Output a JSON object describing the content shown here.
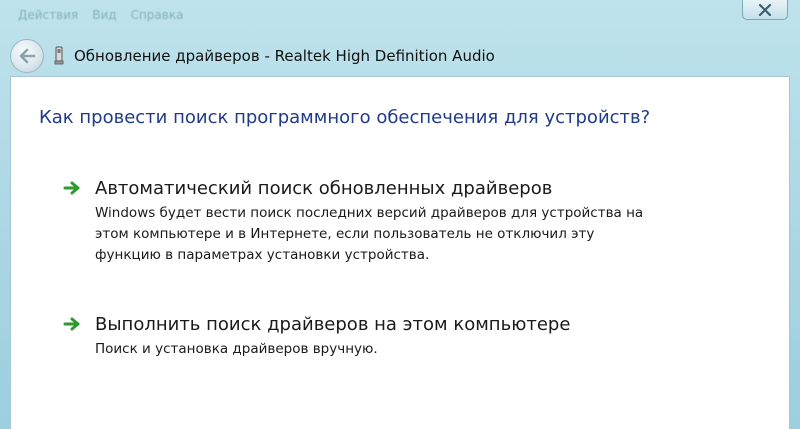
{
  "menu": {
    "items": [
      "Действия",
      "Вид",
      "Справка"
    ]
  },
  "window": {
    "title": "Обновление драйверов - Realtek High Definition Audio"
  },
  "content": {
    "heading": "Как провести поиск программного обеспечения для устройств?",
    "options": [
      {
        "title": "Автоматический поиск обновленных драйверов",
        "description": "Windows будет вести поиск последних версий драйверов для устройства на этом компьютере и в Интернете, если пользователь не отключил эту функцию в параметрах установки устройства."
      },
      {
        "title": "Выполнить поиск драйверов на этом компьютере",
        "description": "Поиск и установка драйверов вручную."
      }
    ]
  },
  "colors": {
    "heading": "#1f3b8a",
    "arrow": "#2e9a2e",
    "frame": "#a9d5e3"
  },
  "icons": {
    "back": "back-arrow-icon",
    "device": "device-icon",
    "close": "close-icon",
    "option_arrow": "green-arrow-icon"
  }
}
